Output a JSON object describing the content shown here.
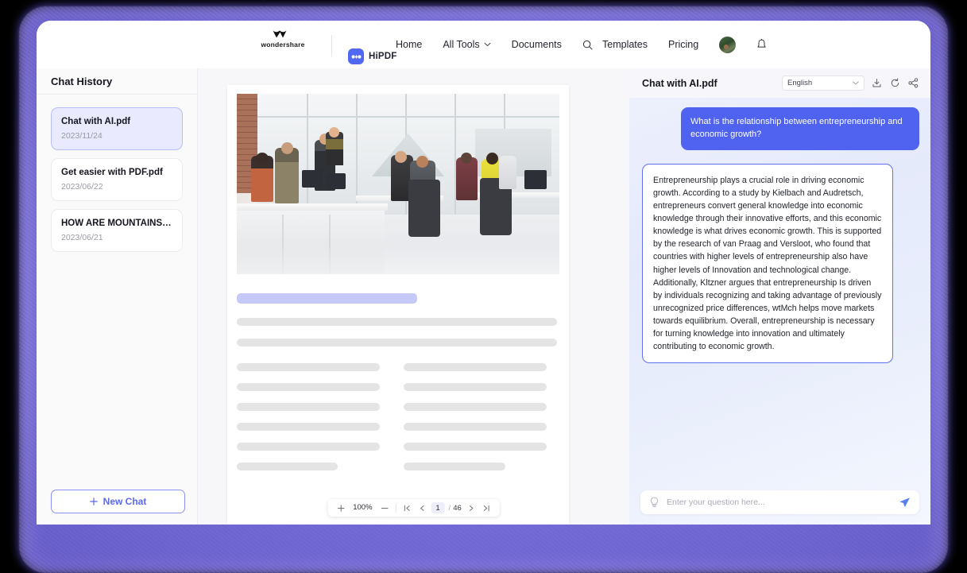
{
  "navbar": {
    "brand_name": "wondershare",
    "product_name": "HiPDF",
    "links": [
      {
        "label": "Home",
        "icon": ""
      },
      {
        "label": "All Tools",
        "icon": "chevron-down-icon"
      },
      {
        "label": "Documents",
        "icon": ""
      }
    ],
    "search_icon": "search-icon",
    "right_links": [
      {
        "label": "Templates"
      },
      {
        "label": "Pricing"
      }
    ],
    "avatar": "user-avatar",
    "bell_icon": "bell-icon"
  },
  "sidebar": {
    "title": "Chat History",
    "items": [
      {
        "name": "Chat with AI.pdf",
        "date": "2023/11/24",
        "active": true
      },
      {
        "name": "Get easier with PDF.pdf",
        "date": "2023/06/22",
        "active": false
      },
      {
        "name": "HOW ARE MOUNTAINS FORME...",
        "date": "2023/06/21",
        "active": false
      }
    ],
    "new_chat_label": "New Chat",
    "new_chat_icon": "plus-icon"
  },
  "viewer": {
    "toolbar": {
      "zoom_in_icon": "plus-icon",
      "zoom_level": "100%",
      "zoom_out_icon": "minus-icon",
      "first_page_icon": "first-page-icon",
      "prev_page_icon": "prev-page-icon",
      "current_page": "1",
      "separator": "/",
      "total_pages": "46",
      "next_page_icon": "next-page-icon",
      "last_page_icon": "last-page-icon"
    },
    "page_image_alt": "office-meeting-photo"
  },
  "chat": {
    "title": "Chat with AI.pdf",
    "language": "English",
    "language_caret": "chevron-down-icon",
    "actions": [
      {
        "icon": "download-icon"
      },
      {
        "icon": "refresh-icon"
      },
      {
        "icon": "share-icon"
      }
    ],
    "messages": [
      {
        "role": "user",
        "text": "What is the relationship between entrepreneurship and economic growth?"
      },
      {
        "role": "assistant",
        "text": "Entrepreneurship plays a crucial role in driving economic growth. According to a study by Kielbach and Audretsch, entrepreneurs convert general knowledge into economic knowledge through their innovative efforts, and this economic knowledge is what drives economic growth. This is supported by the research of van Praag and Versloot, who found that countries with higher levels of entrepreneurship also have higher levels of Innovation and technological change. Additionally, Kltzner argues that entrepreneurship Is driven by individuals recognizing and taking advantage of previously unrecognized price differences, wtMch helps move markets towards equilibrium. Overall, entrepreneurship is necessary for turning knowledge into innovation and ultimately contributing to economic growth."
      }
    ],
    "composer": {
      "hint_icon": "lightbulb-icon",
      "placeholder": "Enter your question here...",
      "value": "",
      "send_icon": "send-icon"
    }
  },
  "colors": {
    "accent": "#5068f2",
    "user_bubble": "#4f63f0",
    "ai_border": "#5f6ff2",
    "active_item": "#e9eafd",
    "glow": "#6a5ce0"
  }
}
